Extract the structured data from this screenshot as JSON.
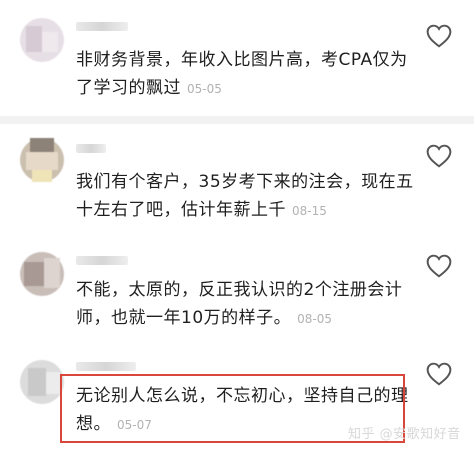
{
  "comments": [
    {
      "text": "非财务背景，年收入比图片高，考CPA仅为了学习的飘过",
      "date": "05-05"
    },
    {
      "text": "我们有个客户，35岁考下来的注会，现在五十左右了吧，估计年薪上千",
      "date": "08-15"
    },
    {
      "text": "不能，太原的，反正我认识的2个注册会计师，也就一年10万的样子。",
      "date": "08-05"
    },
    {
      "text": "无论别人怎么说，不忘初心，坚持自己的理想。",
      "date": "05-07"
    }
  ],
  "icons": {
    "like": "heart-outline-icon"
  },
  "colors": {
    "highlight_border": "#d9463a",
    "date": "#b2b2b2",
    "divider": "#f2f2f2"
  },
  "watermark": "知乎 @安歌知好音"
}
